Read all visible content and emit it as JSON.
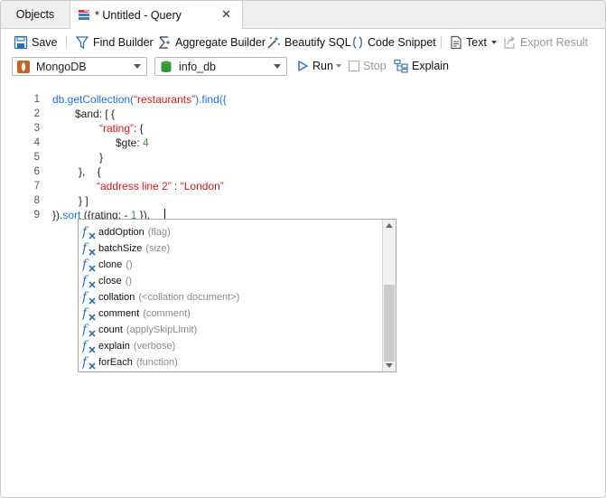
{
  "tabs": {
    "objects": "Objects",
    "query": "* Untitled - Query",
    "close_glyph": "✕"
  },
  "toolbar": {
    "save": "Save",
    "find_builder": "Find Builder",
    "aggregate_builder": "Aggregate Builder",
    "beautify": "Beautify SQL",
    "code_snippet": "Code Snippet",
    "text": "Text",
    "export": "Export Result"
  },
  "connection": {
    "server": "MongoDB",
    "database": "info_db",
    "run": "Run",
    "stop": "Stop",
    "explain": "Explain"
  },
  "editor": {
    "line_numbers": [
      "1",
      "2",
      "3",
      "4",
      "5",
      "6",
      "7",
      "8",
      "9"
    ],
    "l1": {
      "a": "db.getCollection(",
      "b": "“restaurants”",
      "c": ").find({"
    },
    "l2": "$and: [ {",
    "l3": {
      "a": "“rating”",
      "b": ": {"
    },
    "l4": {
      "a": "$gte: ",
      "b": "4"
    },
    "l5": "}",
    "l6": "},    {",
    "l7": {
      "a": "“address line 2”",
      "b": " : ",
      "c": "“London”"
    },
    "l8": "} ]",
    "l9": {
      "a": "}).",
      "b": "sort",
      "c": " ({rating: - ",
      "d": "1",
      "e": " })."
    }
  },
  "autocomplete": [
    {
      "name": "addOption",
      "param": "(flag)"
    },
    {
      "name": "batchSize",
      "param": "(size)"
    },
    {
      "name": "clone",
      "param": "()"
    },
    {
      "name": "close",
      "param": "()"
    },
    {
      "name": "collation",
      "param": "(<collation document>)"
    },
    {
      "name": "comment",
      "param": "(comment)"
    },
    {
      "name": "count",
      "param": "(applySkipLimit)"
    },
    {
      "name": "explain",
      "param": "(verbose)"
    },
    {
      "name": "forEach",
      "param": "(function)"
    }
  ]
}
